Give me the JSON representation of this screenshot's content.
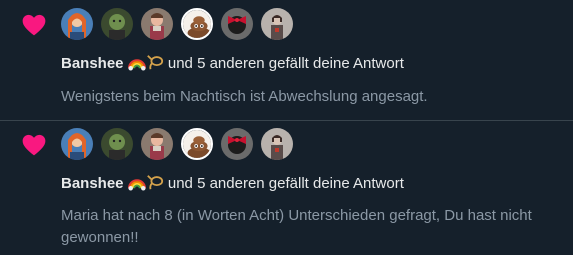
{
  "colors": {
    "background": "#15202b",
    "heart": "#f91880",
    "text_primary": "#e7e9ea",
    "text_secondary": "#8b98a5",
    "divider": "#38444d"
  },
  "notifications": [
    {
      "icon": "heart-icon",
      "avatars": [
        "avatar-redhead",
        "avatar-green-skin",
        "avatar-costume",
        "avatar-brown-poop",
        "avatar-dark-red-bow",
        "avatar-grey-figure"
      ],
      "actor_name": "Banshee",
      "actor_emojis": [
        "rainbow-emoji",
        "lasso-emoji"
      ],
      "action_text": "und 5 anderen gefällt deine Antwort",
      "body": "Wenigstens beim Nachtisch ist Abwechslung angesagt."
    },
    {
      "icon": "heart-icon",
      "avatars": [
        "avatar-redhead",
        "avatar-green-skin",
        "avatar-costume",
        "avatar-brown-poop",
        "avatar-dark-red-bow",
        "avatar-grey-figure"
      ],
      "actor_name": "Banshee",
      "actor_emojis": [
        "rainbow-emoji",
        "lasso-emoji"
      ],
      "action_text": "und 5 anderen gefällt deine Antwort",
      "body": "Maria hat nach 8 (in Worten Acht) Unterschieden gefragt, Du hast nicht gewonnen!!"
    }
  ]
}
